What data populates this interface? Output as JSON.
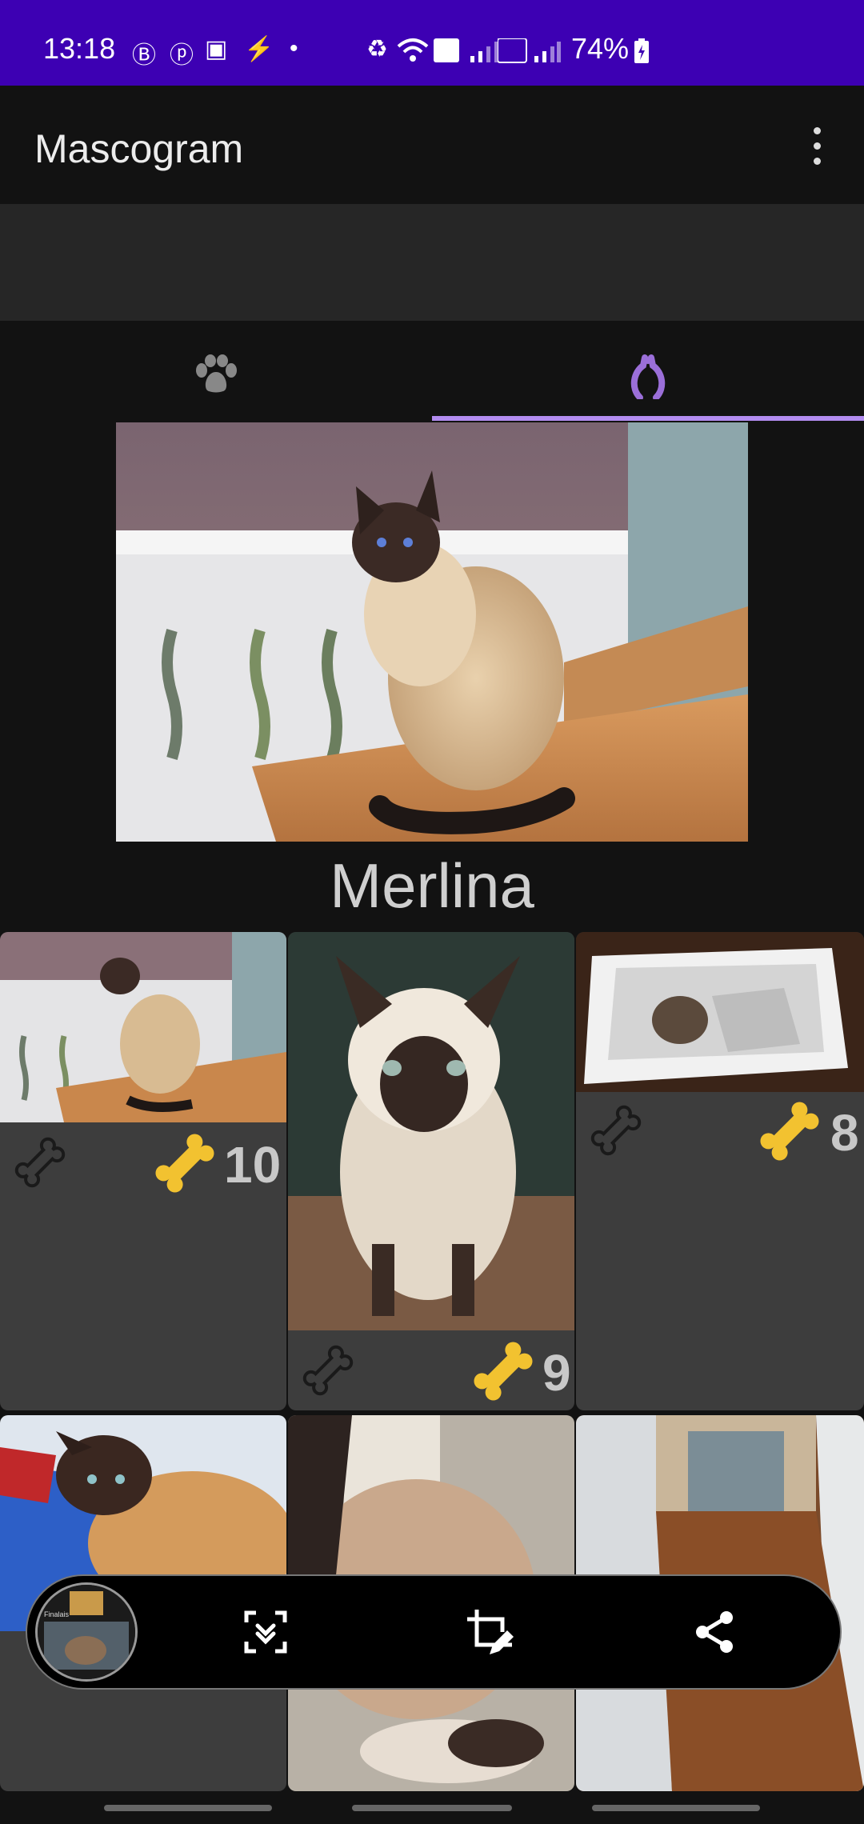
{
  "status_bar": {
    "time": "13:18",
    "battery": "74%"
  },
  "app": {
    "title": "Mascogram",
    "more_icon": "more-vert-icon"
  },
  "tabs": [
    {
      "icon": "paw-icon",
      "selected": false
    },
    {
      "icon": "grooming-icon",
      "selected": true
    }
  ],
  "profile": {
    "name": "Merlina"
  },
  "grid": {
    "items": [
      {
        "likes": "10"
      },
      {
        "likes": "9"
      },
      {
        "likes": "8"
      }
    ]
  },
  "screenshot_toolbar": {
    "thumb_label": "Finalais",
    "actions": [
      "scroll-capture-icon",
      "crop-edit-icon",
      "share-icon"
    ]
  },
  "colors": {
    "status_bar": "#3d00b3",
    "accent": "#b28cf0",
    "bone_yellow": "#f2c230",
    "card": "#3d3d3d"
  }
}
